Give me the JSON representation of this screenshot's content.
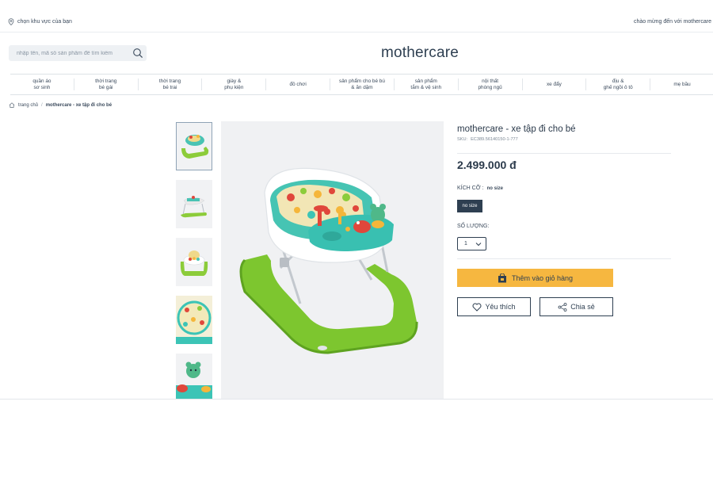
{
  "topbar": {
    "location_text": "chọn khu vực của bạn",
    "welcome_text": "chào mừng đến với mothercare"
  },
  "header": {
    "search_placeholder": "nhập tên, mã số sản phẩm để tìm kiếm",
    "logo": "mothercare"
  },
  "nav": {
    "items": [
      "quần áo\nsơ sinh",
      "thời trang\nbé gái",
      "thời trang\nbé trai",
      "giày &\nphụ kiện",
      "đồ chơi",
      "sản phẩm cho bé bú\n& ăn dặm",
      "sản phẩm\ntắm & vệ sinh",
      "nội thất\nphòng ngủ",
      "xe đẩy",
      "địu &\nghế ngồi ô tô",
      "mẹ bầu"
    ]
  },
  "breadcrumb": {
    "home": "trang chủ",
    "separator": "/",
    "current": "mothercare - xe tập đi cho bé"
  },
  "product": {
    "title": "mothercare - xe tập đi cho bé",
    "sku_label": "SKU:",
    "sku_value": "EC389.56140150-1-777",
    "price": "2.499.000 đ",
    "size_label": "KÍCH CỠ :",
    "size_value": "no size",
    "size_option": "no size",
    "quantity_label": "SỐ LƯỢNG:",
    "quantity_value": "1",
    "add_to_cart": "Thêm vào giỏ hàng",
    "wishlist": "Yêu thích",
    "share": "Chia sẻ"
  },
  "colors": {
    "accent": "#f6b740",
    "brand": "#2e3f51",
    "product_green": "#7dc62f",
    "product_teal": "#3cc4b6"
  }
}
